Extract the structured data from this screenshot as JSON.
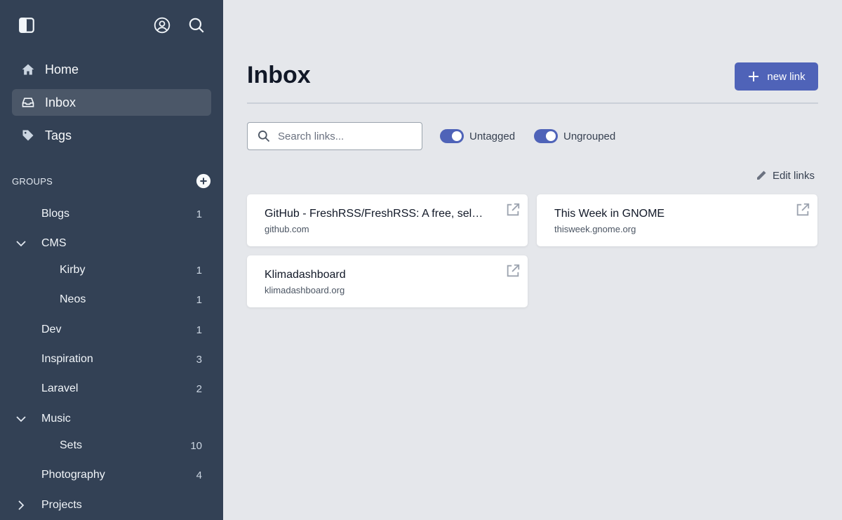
{
  "sidebar": {
    "nav": [
      {
        "label": "Home",
        "icon": "home-icon",
        "active": false
      },
      {
        "label": "Inbox",
        "icon": "inbox-icon",
        "active": true
      },
      {
        "label": "Tags",
        "icon": "tag-icon",
        "active": false
      }
    ],
    "groups_title": "GROUPS",
    "groups": [
      {
        "label": "Blogs",
        "count": "1",
        "level": 0,
        "chevron": "none"
      },
      {
        "label": "CMS",
        "count": "",
        "level": 0,
        "chevron": "down"
      },
      {
        "label": "Kirby",
        "count": "1",
        "level": 1,
        "chevron": "none"
      },
      {
        "label": "Neos",
        "count": "1",
        "level": 1,
        "chevron": "none"
      },
      {
        "label": "Dev",
        "count": "1",
        "level": 0,
        "chevron": "none"
      },
      {
        "label": "Inspiration",
        "count": "3",
        "level": 0,
        "chevron": "none"
      },
      {
        "label": "Laravel",
        "count": "2",
        "level": 0,
        "chevron": "none"
      },
      {
        "label": "Music",
        "count": "",
        "level": 0,
        "chevron": "down"
      },
      {
        "label": "Sets",
        "count": "10",
        "level": 1,
        "chevron": "none"
      },
      {
        "label": "Photography",
        "count": "4",
        "level": 0,
        "chevron": "none"
      },
      {
        "label": "Projects",
        "count": "",
        "level": 0,
        "chevron": "right"
      }
    ]
  },
  "main": {
    "title": "Inbox",
    "new_link_label": "new link",
    "search_placeholder": "Search links...",
    "toggles": [
      {
        "label": "Untagged",
        "on": true
      },
      {
        "label": "Ungrouped",
        "on": true
      }
    ],
    "edit_links_label": "Edit links",
    "cards": [
      {
        "title": "GitHub - FreshRSS/FreshRSS: A free, self-hostable news aggregator",
        "domain": "github.com"
      },
      {
        "title": "This Week in GNOME",
        "domain": "thisweek.gnome.org"
      },
      {
        "title": "Klimadashboard",
        "domain": "klimadashboard.org"
      }
    ]
  },
  "colors": {
    "sidebar_bg": "#334155",
    "active_nav_bg": "#4b5768",
    "accent": "#4f63b8",
    "main_bg": "#e5e7eb"
  }
}
